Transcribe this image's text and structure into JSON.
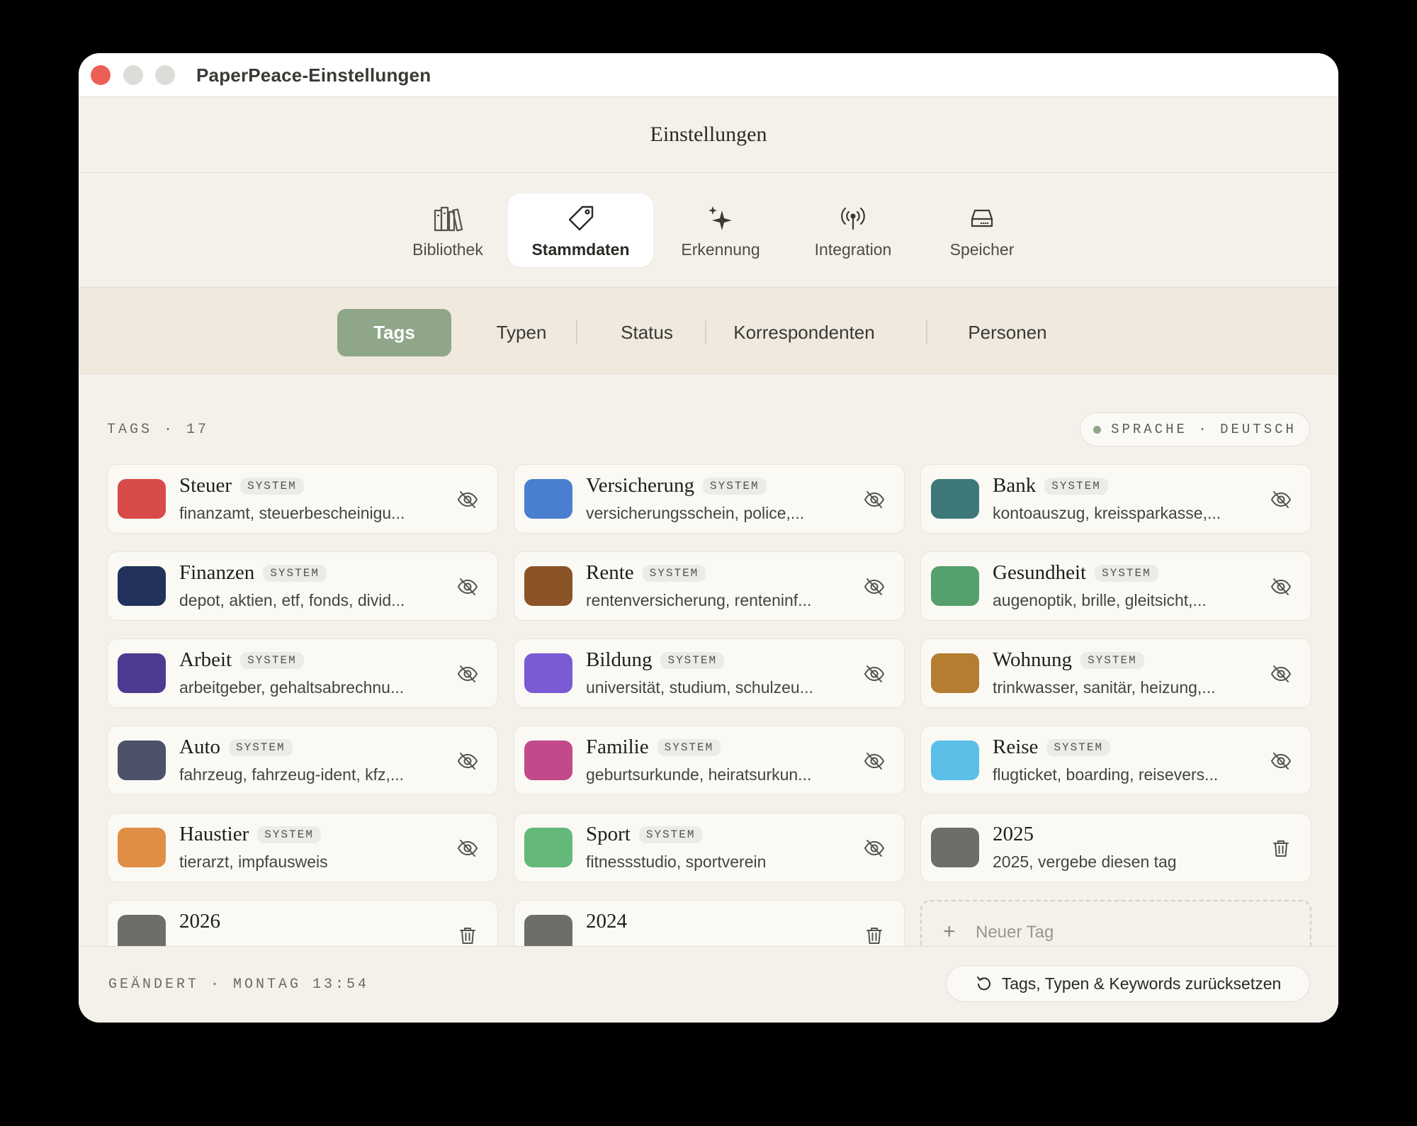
{
  "window": {
    "title": "PaperPeace-Einstellungen"
  },
  "header": {
    "title": "Einstellungen"
  },
  "toolbar": {
    "items": [
      {
        "label": "Bibliothek",
        "icon": "library-icon"
      },
      {
        "label": "Stammdaten",
        "icon": "tag-icon",
        "active": true
      },
      {
        "label": "Erkennung",
        "icon": "sparkles-icon"
      },
      {
        "label": "Integration",
        "icon": "antenna-icon"
      },
      {
        "label": "Speicher",
        "icon": "drive-icon"
      }
    ]
  },
  "segments": {
    "items": [
      {
        "label": "Tags",
        "active": true
      },
      {
        "label": "Typen"
      },
      {
        "label": "Status"
      },
      {
        "label": "Korrespondenten"
      },
      {
        "label": "Personen"
      }
    ]
  },
  "section": {
    "label": "TAGS · 17"
  },
  "language": {
    "label": "SPRACHE · DEUTSCH",
    "accent": "#8fa689"
  },
  "system_badge": "SYSTEM",
  "tags": [
    {
      "name": "Steuer",
      "system": true,
      "keywords": "finanzamt, steuerbescheinigu...",
      "color": "#d84b48"
    },
    {
      "name": "Versicherung",
      "system": true,
      "keywords": "versicherungsschein, police,...",
      "color": "#4a7fcf"
    },
    {
      "name": "Bank",
      "system": true,
      "keywords": "kontoauszug, kreissparkasse,...",
      "color": "#3d7878"
    },
    {
      "name": "Finanzen",
      "system": true,
      "keywords": "depot, aktien, etf, fonds, divid...",
      "color": "#22325a"
    },
    {
      "name": "Rente",
      "system": true,
      "keywords": "rentenversicherung, renteninf...",
      "color": "#8a5428"
    },
    {
      "name": "Gesundheit",
      "system": true,
      "keywords": "augenoptik, brille, gleitsicht,...",
      "color": "#55a06c"
    },
    {
      "name": "Arbeit",
      "system": true,
      "keywords": "arbeitgeber, gehaltsabrechnu...",
      "color": "#4d3a91"
    },
    {
      "name": "Bildung",
      "system": true,
      "keywords": "universität, studium, schulzeu...",
      "color": "#7a5bd3"
    },
    {
      "name": "Wohnung",
      "system": true,
      "keywords": "trinkwasser, sanitär, heizung,...",
      "color": "#b47d32"
    },
    {
      "name": "Auto",
      "system": true,
      "keywords": "fahrzeug, fahrzeug-ident, kfz,...",
      "color": "#4b5269"
    },
    {
      "name": "Familie",
      "system": true,
      "keywords": "geburtsurkunde, heiratsurkun...",
      "color": "#c24a8a"
    },
    {
      "name": "Reise",
      "system": true,
      "keywords": "flugticket, boarding, reisevers...",
      "color": "#5bbfe8"
    },
    {
      "name": "Haustier",
      "system": true,
      "keywords": "tierarzt, impfausweis",
      "color": "#e08e45"
    },
    {
      "name": "Sport",
      "system": true,
      "keywords": "fitnessstudio, sportverein",
      "color": "#63b87a"
    },
    {
      "name": "2025",
      "system": false,
      "keywords": "2025, vergebe diesen tag",
      "color": "#6b6e69"
    },
    {
      "name": "2026",
      "system": false,
      "keywords": "",
      "color": "#6b6e69"
    },
    {
      "name": "2024",
      "system": false,
      "keywords": "",
      "color": "#6b6e69"
    }
  ],
  "new_tag": {
    "placeholder": "Neuer Tag"
  },
  "footer": {
    "changed": "GEÄNDERT · MONTAG 13:54",
    "reset_label": "Tags, Typen & Keywords zurücksetzen"
  }
}
